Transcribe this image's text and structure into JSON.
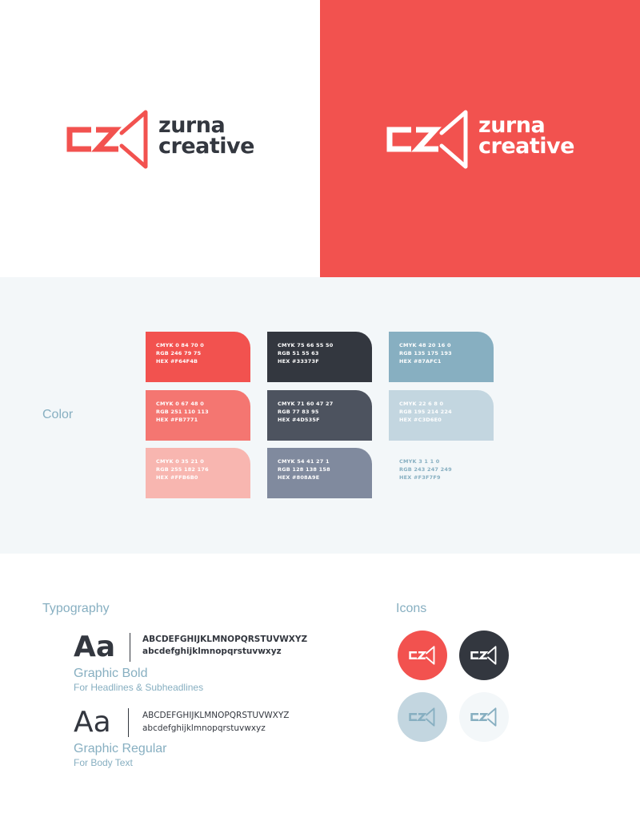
{
  "brand": {
    "name_line1": "zurna",
    "name_line2": "creative",
    "mark_letters": "CZ"
  },
  "colors": {
    "primary": "#F2524F",
    "dark": "#33373F",
    "blue": "#87AFC1",
    "light_bg": "#F3F7F9"
  },
  "color_section": {
    "label": "Color",
    "swatches": [
      {
        "cmyk": "CMYK 0 84 70 0",
        "rgb": "RGB 246 79 75",
        "hex": "HEX #F64F4B",
        "fill": "#F2524F",
        "text_color": "#ffffff"
      },
      {
        "cmyk": "CMYK 0 67 48 0",
        "rgb": "RGB 251 110 113",
        "hex": "HEX #FB7771",
        "fill": "#F47671",
        "text_color": "#ffffff"
      },
      {
        "cmyk": "CMYK 0 35 21 0",
        "rgb": "RGB 255 182 176",
        "hex": "HEX #FFB6B0",
        "fill": "#F8B6B0",
        "text_color": "#ffffff"
      },
      {
        "cmyk": "CMYK 75 66 55 50",
        "rgb": "RGB 51 55 63",
        "hex": "HEX #33373F",
        "fill": "#33373F",
        "text_color": "#ffffff"
      },
      {
        "cmyk": "CMYK 71 60 47 27",
        "rgb": "RGB 77 83 95",
        "hex": "HEX #4D535F",
        "fill": "#4D535F",
        "text_color": "#ffffff"
      },
      {
        "cmyk": "CMYK 54 41 27 1",
        "rgb": "RGB 128 138 158",
        "hex": "HEX #808A9E",
        "fill": "#808A9E",
        "text_color": "#ffffff"
      },
      {
        "cmyk": "CMYK 48 20 16 0",
        "rgb": "RGB 135 175 193",
        "hex": "HEX #87AFC1",
        "fill": "#87AFC1",
        "text_color": "#ffffff"
      },
      {
        "cmyk": "CMYK 22 6 8 0",
        "rgb": "RGB 195 214 224",
        "hex": "HEX #C3D6E0",
        "fill": "#C3D6E0",
        "text_color": "#ffffff"
      },
      {
        "cmyk": "CMYK 3 1 1 0",
        "rgb": "RGB 243 247 249",
        "hex": "HEX #F3F7F9",
        "fill": "#F3F7F9",
        "text_color": "#87AFC1"
      }
    ]
  },
  "typography": {
    "label": "Typography",
    "fonts": [
      {
        "sample": "Aa",
        "upper": "ABCDEFGHIJKLMNOPQRSTUVWXYZ",
        "lower": "abcdefghijklmnopqrstuvwxyz",
        "name": "Graphic Bold",
        "usage": "For Headlines & Subheadlines"
      },
      {
        "sample": "Aa",
        "upper": "ABCDEFGHIJKLMNOPQRSTUVWXYZ",
        "lower": "abcdefghijklmnopqrstuvwxyz",
        "name": "Graphic Regular",
        "usage": "For Body Text"
      }
    ]
  },
  "icons": {
    "label": "Icons",
    "variants": [
      {
        "bg": "#F2524F",
        "fg": "#ffffff"
      },
      {
        "bg": "#33373F",
        "fg": "#ffffff"
      },
      {
        "bg": "#C3D6E0",
        "fg": "#87AFC1"
      },
      {
        "bg": "#F3F7F9",
        "fg": "#87AFC1"
      }
    ]
  }
}
